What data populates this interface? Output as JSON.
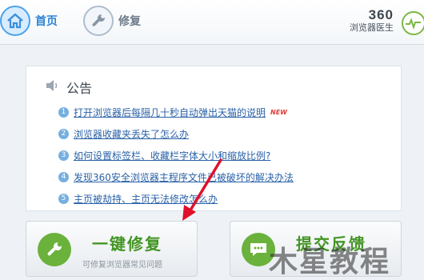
{
  "header": {
    "tabs": [
      {
        "label": "首页",
        "icon": "home-icon",
        "active": true
      },
      {
        "label": "修复",
        "icon": "wrench-icon",
        "active": false
      }
    ],
    "brand": {
      "number": "360",
      "name": "浏览器医生"
    }
  },
  "notice": {
    "title": "公告",
    "items": [
      {
        "index": "1",
        "text": "打开浏览器后每隔几十秒自动弹出天猫的说明",
        "badge": "NEW"
      },
      {
        "index": "2",
        "text": "浏览器收藏夹丢失了怎么办"
      },
      {
        "index": "3",
        "text": "如何设置标签栏、收藏栏字体大小和缩放比例?"
      },
      {
        "index": "4",
        "text": "发现360安全浏览器主程序文件已被破坏的解决办法"
      },
      {
        "index": "5",
        "text": "主页被劫持、主页无法修改怎么办"
      }
    ]
  },
  "actions": {
    "repair": {
      "title": "一键修复",
      "subtitle": "可修复浏览器常见问题",
      "icon": "wrench-icon"
    },
    "feedback": {
      "title": "提交反馈",
      "subtitle": "",
      "icon": "chat-bubble-icon"
    }
  },
  "watermark": {
    "text": "木星教程"
  },
  "colors": {
    "accent": "#2b83d4",
    "green": "#6ab23c",
    "link": "#2a62a8",
    "new": "#e23a3a",
    "arrow": "#e0102a"
  }
}
